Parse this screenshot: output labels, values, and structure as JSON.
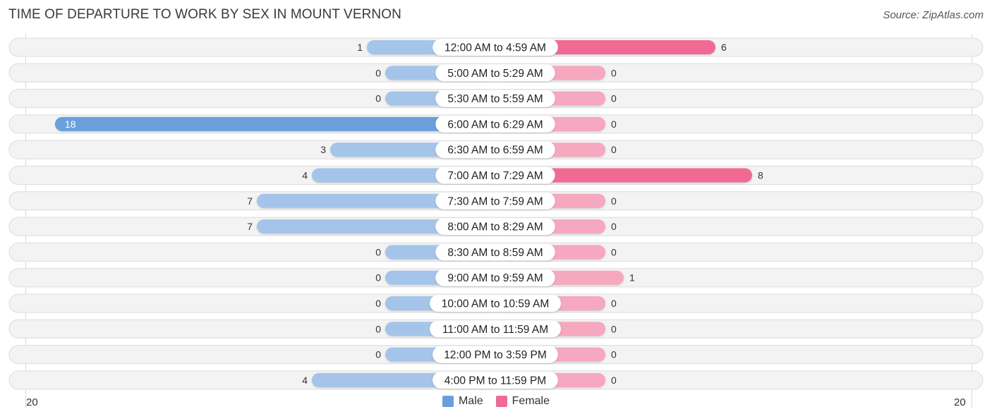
{
  "header": {
    "title": "TIME OF DEPARTURE TO WORK BY SEX IN MOUNT VERNON",
    "source": "Source: ZipAtlas.com"
  },
  "colors": {
    "male": "#6a9fdc",
    "male_light": "#a4c5e9",
    "female": "#f06a93",
    "female_light": "#f5a8c0",
    "row_bg": "#f3f3f3",
    "row_border": "#dcdcdc"
  },
  "chart_data": {
    "type": "bar",
    "orientation": "horizontal-diverging",
    "title": "TIME OF DEPARTURE TO WORK BY SEX IN MOUNT VERNON",
    "categories": [
      "12:00 AM to 4:59 AM",
      "5:00 AM to 5:29 AM",
      "5:30 AM to 5:59 AM",
      "6:00 AM to 6:29 AM",
      "6:30 AM to 6:59 AM",
      "7:00 AM to 7:29 AM",
      "7:30 AM to 7:59 AM",
      "8:00 AM to 8:29 AM",
      "8:30 AM to 8:59 AM",
      "9:00 AM to 9:59 AM",
      "10:00 AM to 10:59 AM",
      "11:00 AM to 11:59 AM",
      "12:00 PM to 3:59 PM",
      "4:00 PM to 11:59 PM"
    ],
    "series": [
      {
        "name": "Male",
        "values": [
          1,
          0,
          0,
          18,
          3,
          4,
          7,
          7,
          0,
          0,
          0,
          0,
          0,
          4
        ]
      },
      {
        "name": "Female",
        "values": [
          6,
          0,
          0,
          0,
          0,
          8,
          0,
          0,
          0,
          1,
          0,
          0,
          0,
          0
        ]
      }
    ],
    "axis": {
      "left_label": "20",
      "right_label": "20",
      "max": 20
    },
    "legend": {
      "position": "bottom-center",
      "entries": [
        "Male",
        "Female"
      ]
    },
    "grid": false
  }
}
